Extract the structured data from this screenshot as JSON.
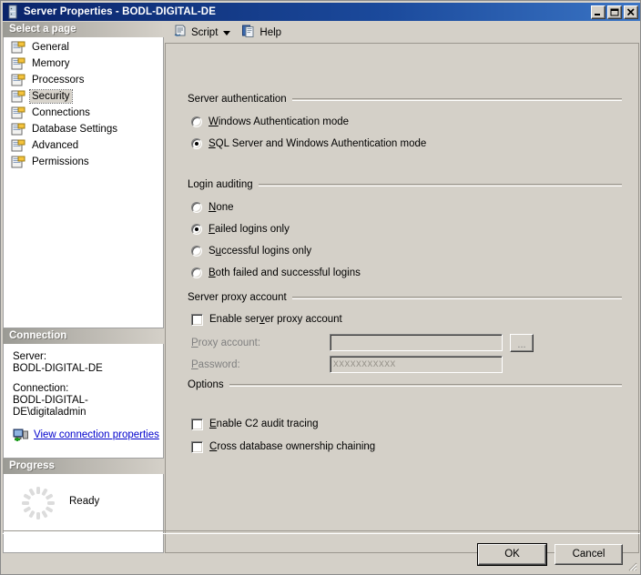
{
  "window": {
    "title": "Server Properties - BODL-DIGITAL-DE",
    "icon": "server-icon",
    "minimize_label": "Minimize",
    "maximize_label": "Maximize",
    "close_label": "Close"
  },
  "sidebar": {
    "header": "Select a page",
    "items": [
      {
        "label": "General",
        "selected": false
      },
      {
        "label": "Memory",
        "selected": false
      },
      {
        "label": "Processors",
        "selected": false
      },
      {
        "label": "Security",
        "selected": true
      },
      {
        "label": "Connections",
        "selected": false
      },
      {
        "label": "Database Settings",
        "selected": false
      },
      {
        "label": "Advanced",
        "selected": false
      },
      {
        "label": "Permissions",
        "selected": false
      }
    ],
    "connection": {
      "header": "Connection",
      "server_label": "Server:",
      "server_value": "BODL-DIGITAL-DE",
      "connection_label": "Connection:",
      "connection_value": "BODL-DIGITAL-DE\\digitaladmin",
      "view_properties_link": "View connection properties"
    },
    "progress": {
      "header": "Progress",
      "status": "Ready"
    }
  },
  "toolbar": {
    "script_label": "Script",
    "help_label": "Help"
  },
  "main": {
    "server_authentication": {
      "title": "Server authentication",
      "options": [
        {
          "label": "Windows Authentication mode",
          "accel": "W",
          "selected": false
        },
        {
          "label": "SQL Server and Windows Authentication mode",
          "accel": "S",
          "selected": true
        }
      ]
    },
    "login_auditing": {
      "title": "Login auditing",
      "options": [
        {
          "label": "None",
          "accel": "N",
          "selected": false
        },
        {
          "label": "Failed logins only",
          "accel": "F",
          "selected": true
        },
        {
          "label": "Successful logins only",
          "accel": "u",
          "selected": false
        },
        {
          "label": "Both failed and successful logins",
          "accel": "B",
          "selected": false
        }
      ]
    },
    "server_proxy_account": {
      "title": "Server proxy account",
      "enable_label": "Enable server proxy account",
      "enable_checked": false,
      "proxy_account_label": "Proxy account:",
      "proxy_account_value": "",
      "browse_button_label": "...",
      "password_label": "Password:",
      "password_value": "xxxxxxxxxxx"
    },
    "options": {
      "title": "Options",
      "checkboxes": [
        {
          "label": "Enable C2 audit tracing",
          "accel": "E",
          "checked": false
        },
        {
          "label": "Cross database ownership chaining",
          "accel": "C",
          "checked": false
        }
      ]
    }
  },
  "footer": {
    "ok_label": "OK",
    "cancel_label": "Cancel"
  },
  "colors": {
    "title_bar_start": "#0a246a",
    "title_bar_end": "#3a74c4",
    "dialog_face": "#d4d0c8",
    "link": "#0000cc"
  }
}
